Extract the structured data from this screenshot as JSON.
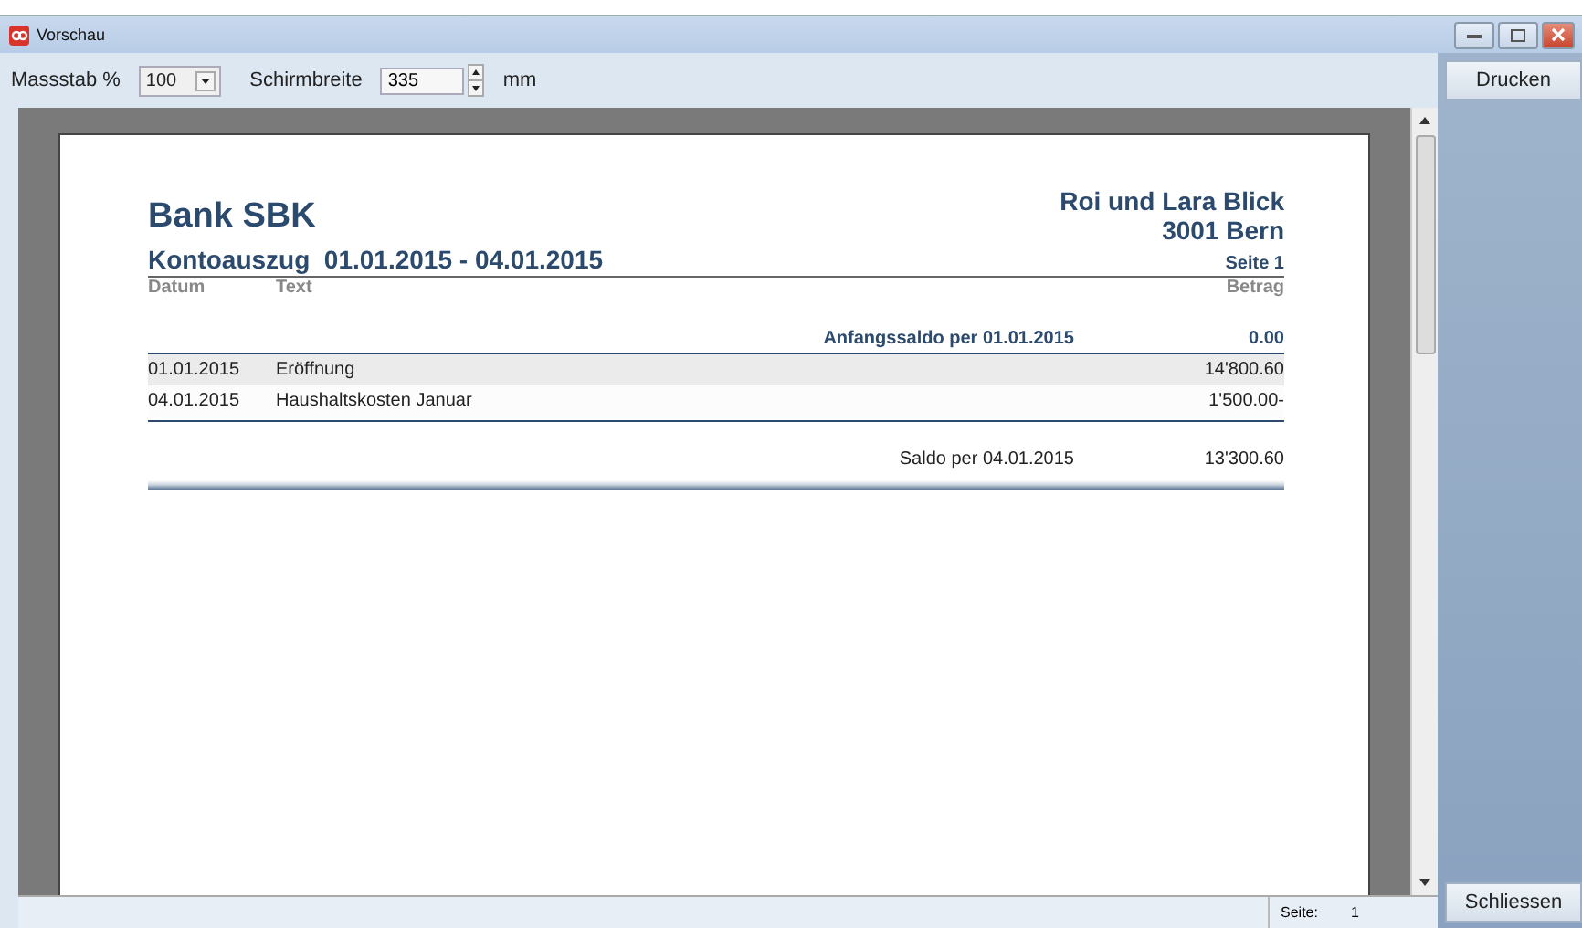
{
  "window": {
    "title": "Vorschau"
  },
  "toolbar": {
    "scale_label": "Massstab %",
    "scale_value": "100",
    "width_label": "Schirmbreite",
    "width_value": "335",
    "width_unit": "mm"
  },
  "page": {
    "bank": "Bank SBK",
    "owner": "Roi und Lara Blick",
    "city": "3001 Bern",
    "title": "Kontoauszug  01.01.2015 - 04.01.2015",
    "page_label": "Seite 1",
    "columns": [
      "Datum",
      "Text",
      "Betrag"
    ],
    "opening": {
      "label": "Anfangssaldo per 01.01.2015",
      "amount": "0.00"
    },
    "rows": [
      {
        "date": "01.01.2015",
        "text": "Eröffnung",
        "amount": "14'800.60",
        "shaded": true
      },
      {
        "date": "04.01.2015",
        "text": "Haushaltskosten Januar",
        "amount": "1'500.00-",
        "shaded": false
      }
    ],
    "closing": {
      "label": "Saldo per 04.01.2015",
      "amount": "13'300.60"
    }
  },
  "buttons": {
    "print": "Drucken",
    "close": "Schliessen"
  },
  "status_bar": {
    "page_label": "Seite:",
    "page_value": "1"
  }
}
